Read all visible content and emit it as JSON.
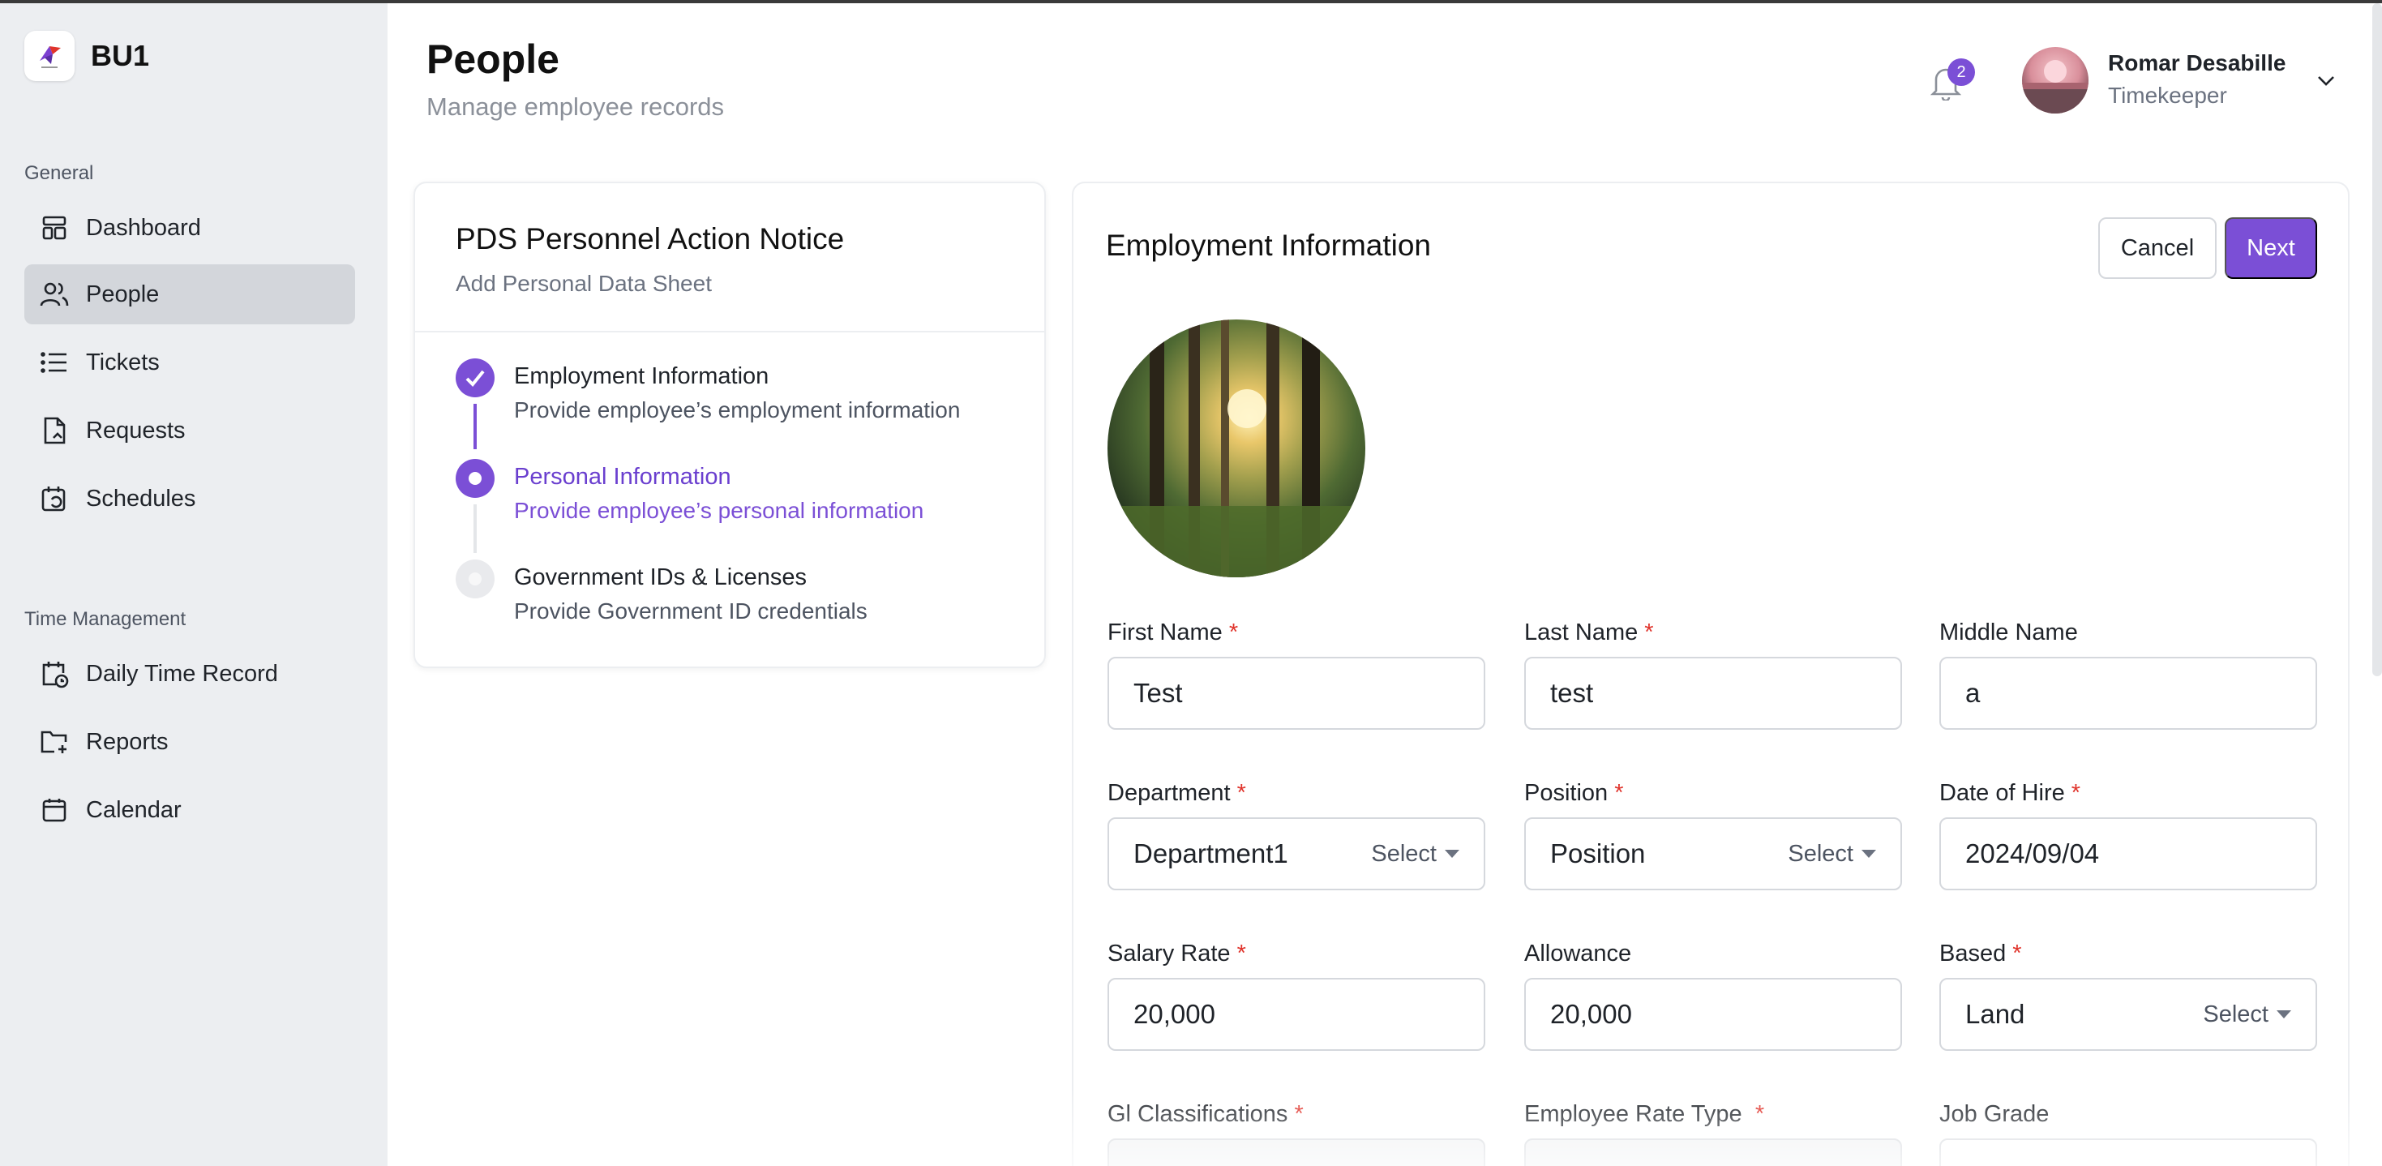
{
  "brand": {
    "name": "BU1",
    "logo_icon": "bird-logo-icon"
  },
  "sidebar": {
    "general_label": "General",
    "general_items": [
      {
        "label": "Dashboard",
        "icon": "dashboard-icon",
        "active": false
      },
      {
        "label": "People",
        "icon": "people-icon",
        "active": true
      },
      {
        "label": "Tickets",
        "icon": "list-icon",
        "active": false
      },
      {
        "label": "Requests",
        "icon": "document-icon",
        "active": false
      },
      {
        "label": "Schedules",
        "icon": "calendar-refresh-icon",
        "active": false
      }
    ],
    "time_label": "Time Management",
    "time_items": [
      {
        "label": "Daily Time Record",
        "icon": "calendar-clock-icon"
      },
      {
        "label": "Reports",
        "icon": "folder-plus-icon"
      },
      {
        "label": "Calendar",
        "icon": "calendar-icon"
      }
    ]
  },
  "header": {
    "title": "People",
    "subtitle": "Manage employee records",
    "notification_count": "2",
    "user_name": "Romar Desabille",
    "user_role": "Timekeeper"
  },
  "steps": {
    "title": "PDS Personnel Action Notice",
    "subtitle": "Add Personal Data Sheet",
    "items": [
      {
        "title": "Employment Information",
        "desc": "Provide employee’s employment information",
        "state": "done"
      },
      {
        "title": "Personal Information",
        "desc": "Provide employee’s personal information",
        "state": "current"
      },
      {
        "title": "Government IDs & Licenses",
        "desc": "Provide Government ID credentials",
        "state": "pending"
      }
    ]
  },
  "form": {
    "title": "Employment Information",
    "cancel_label": "Cancel",
    "next_label": "Next",
    "select_label": "Select",
    "fields": {
      "first_name": {
        "label": "First Name",
        "value": "Test"
      },
      "last_name": {
        "label": "Last Name",
        "value": "test"
      },
      "middle_name": {
        "label": "Middle Name",
        "value": "a"
      },
      "department": {
        "label": "Department",
        "value": "Department1"
      },
      "position": {
        "label": "Position",
        "value": "Position"
      },
      "date_of_hire": {
        "label": "Date of Hire",
        "value": "2024/09/04"
      },
      "salary_rate": {
        "label": "Salary Rate",
        "value": "20,000"
      },
      "allowance": {
        "label": "Allowance",
        "value": "20,000"
      },
      "based": {
        "label": "Based",
        "value": "Land"
      },
      "gl_classifications": {
        "label": "Gl Classifications",
        "value": ""
      },
      "employee_rate_type": {
        "label": "Employee Rate Type",
        "value": ""
      },
      "job_grade": {
        "label": "Job Grade",
        "value": ""
      }
    }
  },
  "colors": {
    "accent": "#7b4fd6",
    "required": "#e0342c",
    "sidebar_bg": "#eceef1"
  }
}
